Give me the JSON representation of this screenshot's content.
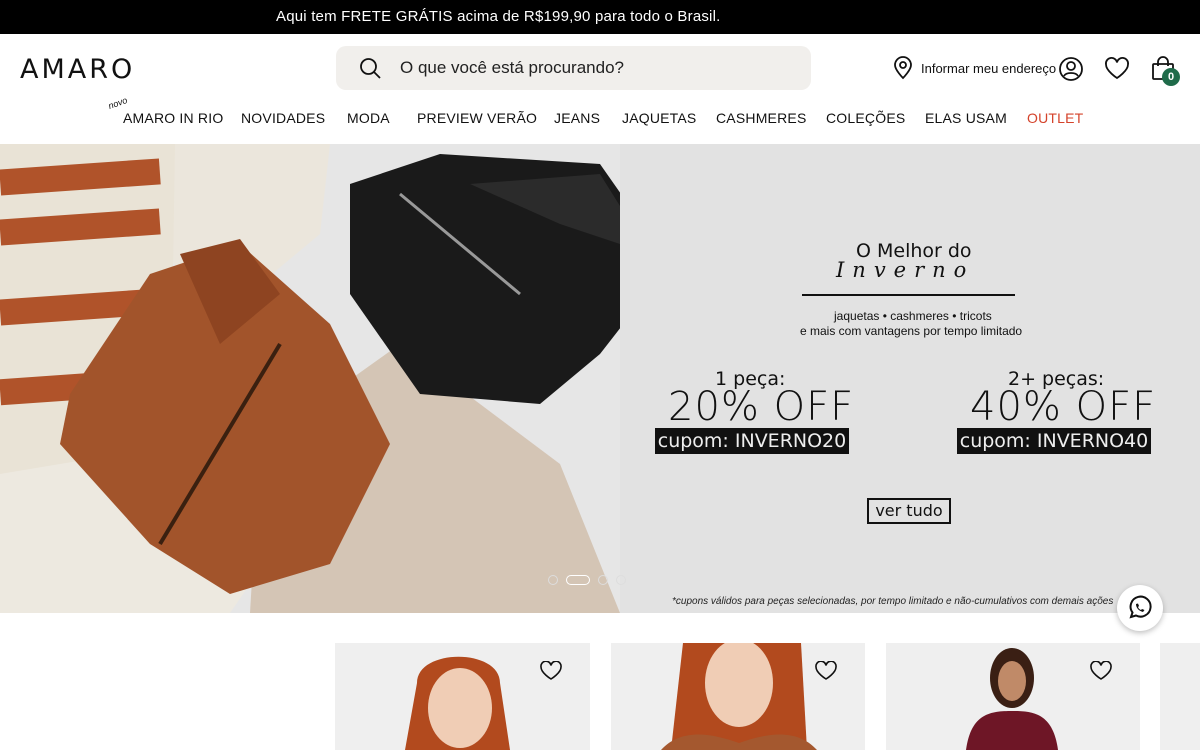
{
  "announcement": "Aqui tem FRETE GRÁTIS acima de R$199,90 para todo o Brasil.",
  "header": {
    "logo": "AMARO",
    "search_placeholder": "O que você está procurando?",
    "address_label": "Informar meu endereço",
    "cart_count": "0"
  },
  "nav": {
    "badge": "novo",
    "items": [
      "AMARO IN RIO",
      "NOVIDADES",
      "MODA",
      "PREVIEW VERÃO",
      "JEANS",
      "JAQUETAS",
      "CASHMERES",
      "COLEÇÕES",
      "ELAS USAM",
      "OUTLET"
    ]
  },
  "hero": {
    "title_line1": "O Melhor do",
    "title_line2": "Inverno",
    "subtitle_line1": "jaquetas • cashmeres • tricots",
    "subtitle_line2": "e mais com vantagens por tempo limitado",
    "offer1": {
      "label": "1 peça:",
      "discount": "20% OFF",
      "coupon": "cupom: INVERNO20"
    },
    "offer2": {
      "label": "2+ peças:",
      "discount": "40% OFF",
      "coupon": "cupom: INVERNO40"
    },
    "cta": "ver tudo",
    "disclaimer": "*cupons válidos para peças selecionadas, por tempo limitado e não-cumulativos com demais ações",
    "slides_count": 4,
    "active_slide": 2
  },
  "colors": {
    "accent_outlet": "#d4432b",
    "cart_badge": "#1f6b4a",
    "topbar": "#000000"
  }
}
